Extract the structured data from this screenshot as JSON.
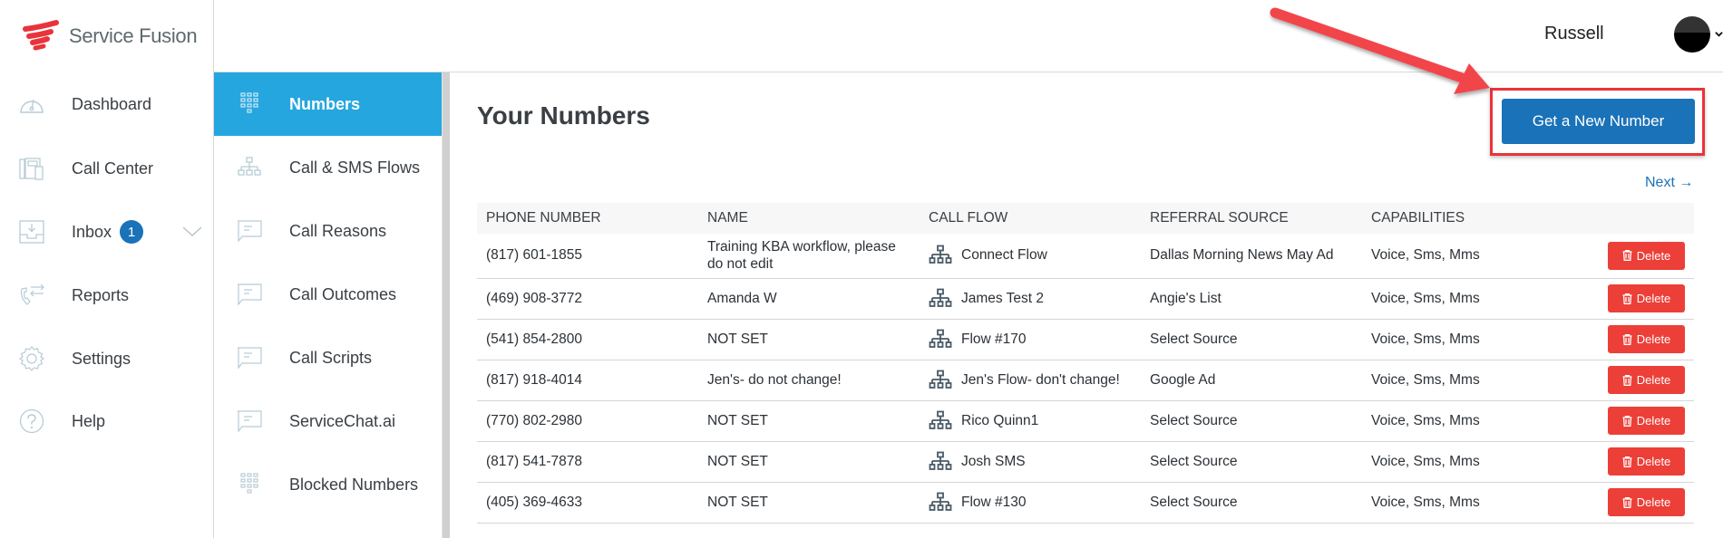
{
  "brand": {
    "name": "Service Fusion",
    "logo_color": "#e9333a"
  },
  "header": {
    "user_name": "Russell"
  },
  "sidebar": {
    "items": [
      {
        "label": "Dashboard",
        "icon": "gauge-icon"
      },
      {
        "label": "Call Center",
        "icon": "phone-devices-icon"
      },
      {
        "label": "Inbox",
        "icon": "inbox-tray-icon",
        "badge": "1",
        "expandable": true
      },
      {
        "label": "Reports",
        "icon": "call-transfer-icon"
      },
      {
        "label": "Settings",
        "icon": "gear-icon"
      },
      {
        "label": "Help",
        "icon": "question-circle-icon"
      }
    ]
  },
  "submenu": {
    "items": [
      {
        "label": "Numbers",
        "icon": "keypad-icon",
        "active": true
      },
      {
        "label": "Call & SMS Flows",
        "icon": "sitemap-icon"
      },
      {
        "label": "Call Reasons",
        "icon": "speech-bubble-icon"
      },
      {
        "label": "Call Outcomes",
        "icon": "speech-bubble-icon"
      },
      {
        "label": "Call Scripts",
        "icon": "speech-bubble-icon"
      },
      {
        "label": "ServiceChat.ai",
        "icon": "speech-bubble-icon"
      },
      {
        "label": "Blocked Numbers",
        "icon": "keypad-icon"
      }
    ]
  },
  "main": {
    "title": "Your Numbers",
    "new_number_button": "Get a New Number",
    "next_link": "Next →",
    "table": {
      "columns": [
        "PHONE NUMBER",
        "NAME",
        "CALL FLOW",
        "REFERRAL SOURCE",
        "CAPABILITIES"
      ],
      "delete_label": "Delete",
      "rows": [
        {
          "phone": "(817) 601-1855",
          "name": "Training KBA workflow, please do not edit",
          "name_set": true,
          "flow": "Connect Flow",
          "referral": "Dallas Morning News May Ad",
          "capabilities": "Voice, Sms, Mms"
        },
        {
          "phone": "(469) 908-3772",
          "name": "Amanda W",
          "name_set": true,
          "flow": "James Test 2",
          "referral": "Angie's List",
          "capabilities": "Voice, Sms, Mms"
        },
        {
          "phone": "(541) 854-2800",
          "name": "NOT SET",
          "name_set": false,
          "flow": "Flow #170",
          "referral": "Select Source",
          "capabilities": "Voice, Sms, Mms"
        },
        {
          "phone": "(817) 918-4014",
          "name": "Jen's- do not change!",
          "name_set": true,
          "flow": "Jen's Flow- don't change!",
          "referral": "Google Ad",
          "capabilities": "Voice, Sms, Mms"
        },
        {
          "phone": "(770) 802-2980",
          "name": "NOT SET",
          "name_set": false,
          "flow": "Rico Quinn1",
          "referral": "Select Source",
          "capabilities": "Voice, Sms, Mms"
        },
        {
          "phone": "(817) 541-7878",
          "name": "NOT SET",
          "name_set": false,
          "flow": "Josh SMS",
          "referral": "Select Source",
          "capabilities": "Voice, Sms, Mms"
        },
        {
          "phone": "(405) 369-4633",
          "name": "NOT SET",
          "name_set": false,
          "flow": "Flow #130",
          "referral": "Select Source",
          "capabilities": "Voice, Sms, Mms"
        }
      ]
    }
  },
  "colors": {
    "primary": "#1a72b8",
    "active_menu": "#26a6de",
    "danger": "#ec3f38",
    "annotation": "#e9333a"
  }
}
